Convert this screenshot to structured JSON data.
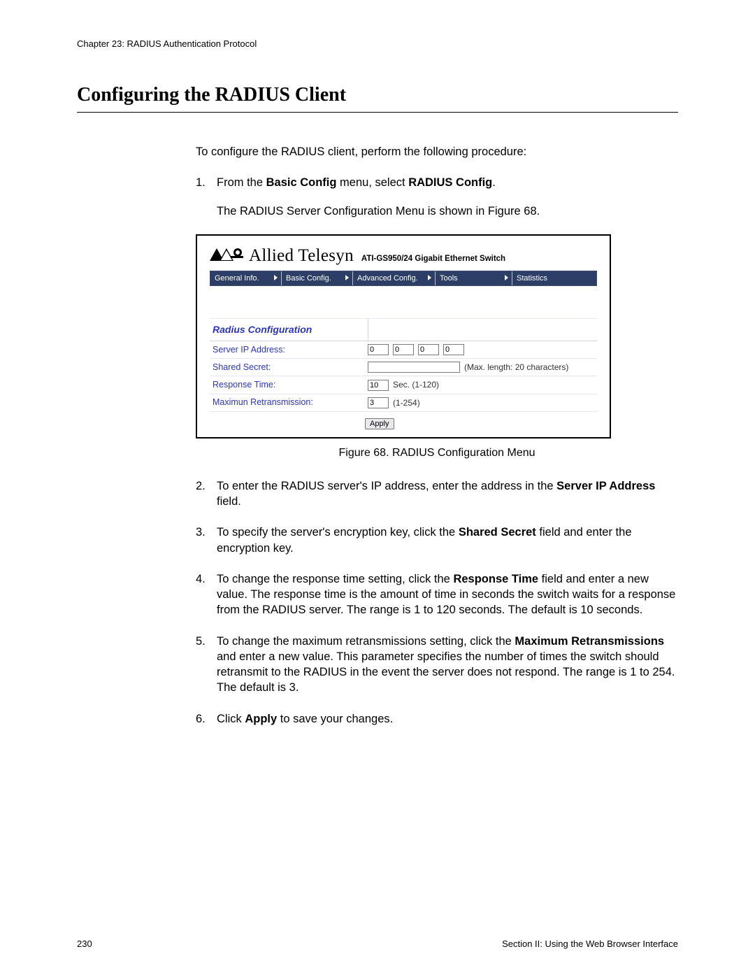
{
  "header": {
    "chapter": "Chapter 23: RADIUS Authentication Protocol"
  },
  "title": "Configuring the RADIUS Client",
  "intro": "To configure the RADIUS client, perform the following procedure:",
  "steps": {
    "s1": {
      "num": "1.",
      "a": "From the ",
      "b1": "Basic Config",
      "c": " menu, select ",
      "b2": "RADIUS Config",
      "d": ".",
      "p2": "The RADIUS Server Configuration Menu is shown in Figure 68."
    },
    "s2": {
      "num": "2.",
      "a": "To enter the RADIUS server's IP address, enter the address in the ",
      "b1": "Server IP Address",
      "c": " field."
    },
    "s3": {
      "num": "3.",
      "a": "To specify the server's encryption key, click the ",
      "b1": "Shared Secret",
      "c": " field and enter the encryption key."
    },
    "s4": {
      "num": "4.",
      "a": "To change the response time setting, click the ",
      "b1": "Response Time",
      "c": " field and enter a new value. The response time is the amount of time in seconds the switch waits for a response from the RADIUS server. The range is 1 to 120 seconds. The default is 10 seconds."
    },
    "s5": {
      "num": "5.",
      "a": "To change the maximum retransmissions setting, click the ",
      "b1": "Maximum Retransmissions",
      "c": " and enter a new value. This parameter specifies the number of times the switch should retransmit to the RADIUS in the event the server does not respond. The range is 1 to 254. The default is 3."
    },
    "s6": {
      "num": "6.",
      "a": "Click ",
      "b1": "Apply",
      "c": " to save your changes."
    }
  },
  "figure": {
    "brand": "Allied Telesyn",
    "model": "ATI-GS950/24 Gigabit Ethernet Switch",
    "menu": [
      "General Info.",
      "Basic Config.",
      "Advanced Config.",
      "Tools",
      "Statistics"
    ],
    "section_title": "Radius Configuration",
    "rows": {
      "ip_label": "Server IP Address:",
      "ip": [
        "0",
        "0",
        "0",
        "0"
      ],
      "secret_label": "Shared Secret:",
      "secret_hint": "(Max. length: 20 characters)",
      "resp_label": "Response Time:",
      "resp_val": "10",
      "resp_hint": "Sec. (1-120)",
      "retr_label": "Maximun Retransmission:",
      "retr_val": "3",
      "retr_hint": "(1-254)"
    },
    "apply": "Apply",
    "caption": "Figure 68. RADIUS Configuration Menu"
  },
  "footer": {
    "page": "230",
    "section": "Section II: Using the Web Browser Interface"
  }
}
